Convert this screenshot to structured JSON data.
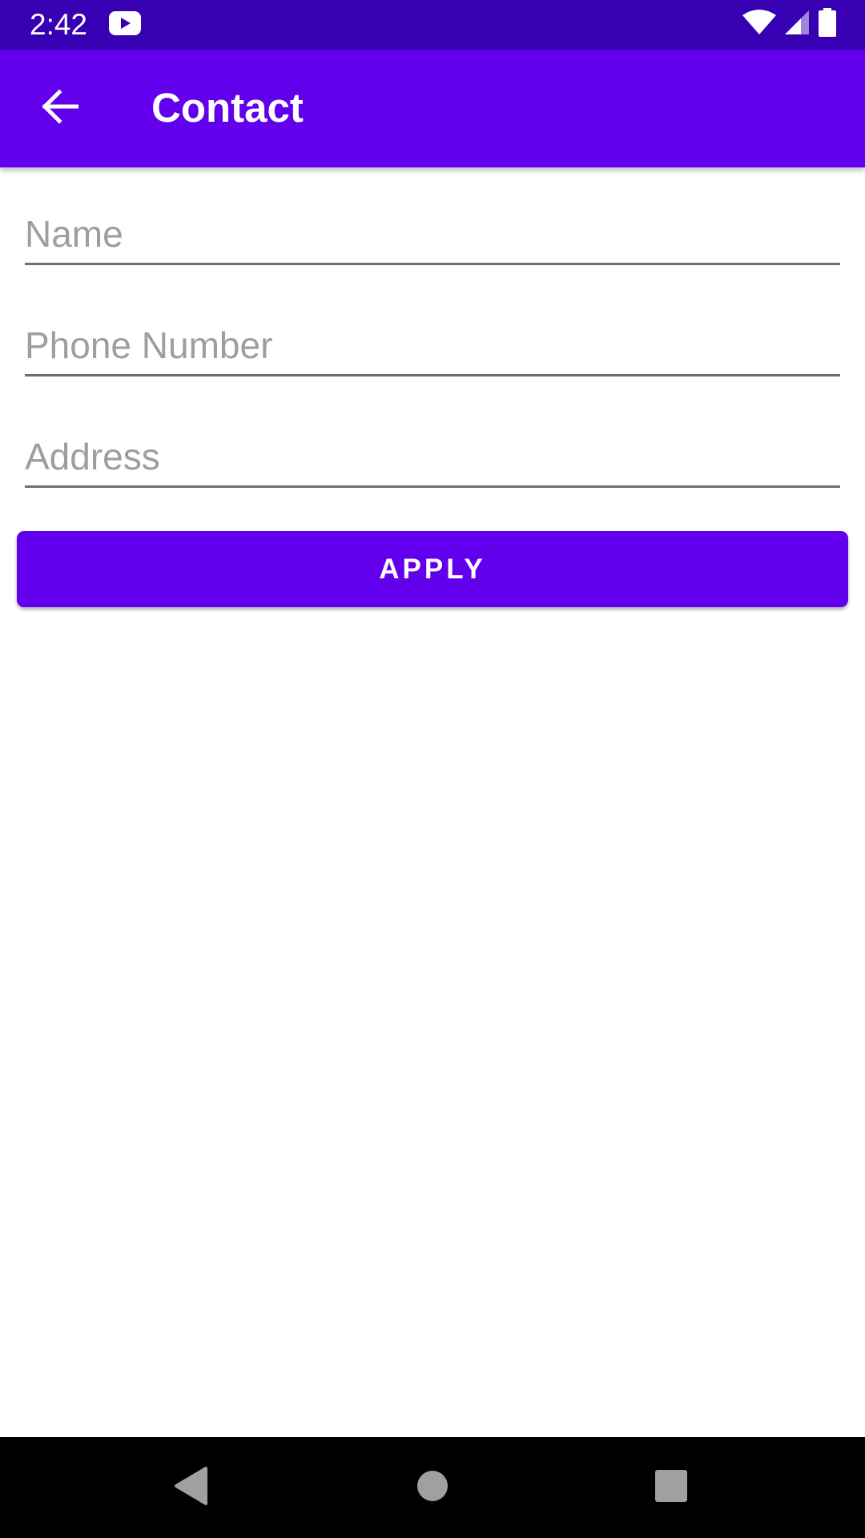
{
  "status_bar": {
    "time": "2:42",
    "icons": [
      "youtube-icon",
      "wifi-icon",
      "cell-signal-icon",
      "battery-icon"
    ],
    "background": "#3700b3"
  },
  "app_bar": {
    "title": "Contact",
    "back_icon": "arrow-back-icon",
    "background": "#6200ee"
  },
  "form": {
    "fields": [
      {
        "placeholder": "Name",
        "value": ""
      },
      {
        "placeholder": "Phone Number",
        "value": ""
      },
      {
        "placeholder": "Address",
        "value": ""
      }
    ],
    "apply_label": "APPLY",
    "accent": "#6200ee"
  },
  "nav_bar": {
    "icons": [
      "back-triangle-icon",
      "home-circle-icon",
      "recents-square-icon"
    ]
  }
}
